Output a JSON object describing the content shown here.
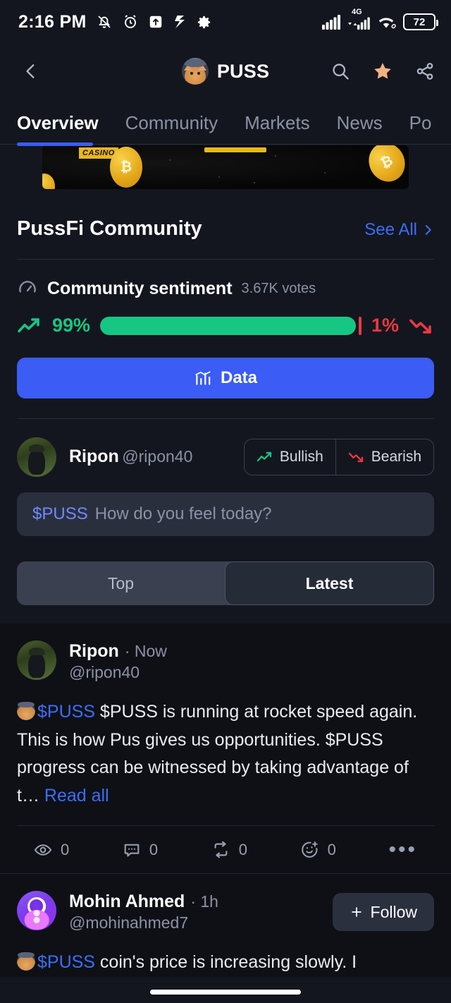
{
  "status_bar": {
    "time": "2:16 PM",
    "icons_left": [
      "bell-muted-icon",
      "alarm-icon",
      "upload-box-icon",
      "s-logo-icon",
      "gear-icon"
    ],
    "network_label": "4G",
    "battery_level": "72",
    "icons_right": [
      "signal-bars-icon",
      "4g-signal-icon",
      "wifi-icon",
      "battery-icon"
    ]
  },
  "header": {
    "back_icon": "chevron-left-icon",
    "coin_name": "PUSS",
    "search_icon": "search-icon",
    "favorite_icon": "star-filled-icon",
    "share_icon": "share-icon"
  },
  "tabs": [
    {
      "label": "Overview",
      "active": true
    },
    {
      "label": "Community",
      "active": false
    },
    {
      "label": "Markets",
      "active": false
    },
    {
      "label": "News",
      "active": false
    },
    {
      "label": "Po",
      "active": false
    }
  ],
  "ad_banner": {
    "badge": "CASINO"
  },
  "community_section": {
    "title": "PussFi Community",
    "see_all": "See All",
    "see_all_icon": "chevron-right-icon"
  },
  "sentiment": {
    "icon": "gauge-icon",
    "title": "Community sentiment",
    "votes": "3.67K votes",
    "bullish_pct": "99%",
    "bearish_pct": "1%",
    "bullish_value": 99,
    "bearish_value": 1,
    "bullish_color": "#16C784",
    "bearish_color": "#EA3943",
    "data_button": "Data",
    "data_button_icon": "bar-chart-icon",
    "data_button_color": "#3B5CF5"
  },
  "composer": {
    "user_name": "Ripon",
    "user_handle": "@ripon40",
    "bullish_label": "Bullish",
    "bearish_label": "Bearish",
    "bullish_icon": "trend-up-icon",
    "bearish_icon": "trend-down-icon",
    "cashtag": "$PUSS",
    "placeholder": "How do you feel today?",
    "input_value": ""
  },
  "feed_toggle": {
    "top": "Top",
    "latest": "Latest",
    "active": "Latest"
  },
  "posts": [
    {
      "author": "Ripon",
      "handle": "@ripon40",
      "time": "· Now",
      "cashtag": "$PUSS",
      "text": " $PUSS is running at rocket speed again.  This is how Pus gives us opportunities. $PUSS progress can be witnessed by taking advantage of t…",
      "read_all": "Read all",
      "show_follow": false,
      "actions": {
        "views": "0",
        "comments": "0",
        "reposts": "0",
        "reactions": "0",
        "more_icon": "ellipsis-icon"
      }
    },
    {
      "author": "Mohin Ahmed",
      "handle": "@mohinahmed7",
      "time": "· 1h",
      "cashtag": "$PUSS",
      "text": " coin's price is increasing slowly. I",
      "read_all": "",
      "show_follow": true,
      "follow_label": "Follow",
      "follow_icon": "plus-icon"
    }
  ]
}
